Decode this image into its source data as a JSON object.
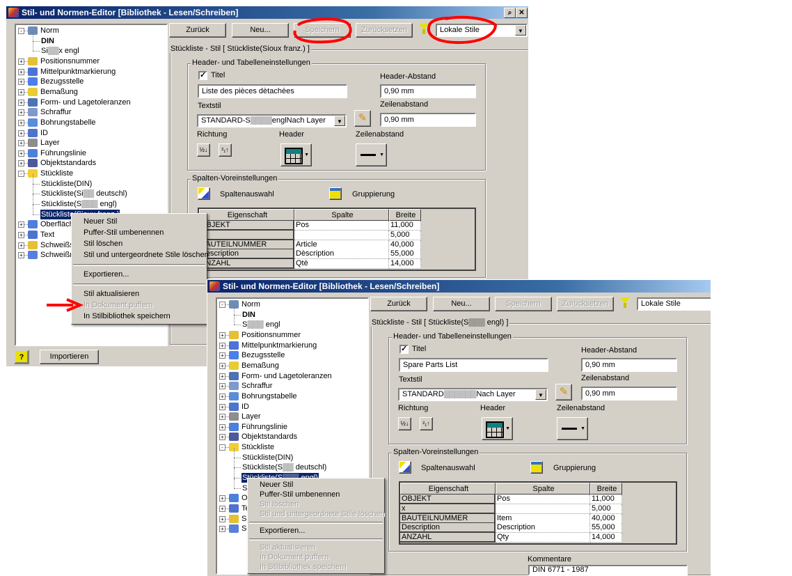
{
  "colors": {
    "titlebar": "#0a246a",
    "window_bg": "#d4d0c8",
    "selection": "#0a246a",
    "annotation": "#ff0000"
  },
  "windows": [
    {
      "title": "Stil- und Normen-Editor [Bibliothek - Lesen/Schreiben]",
      "titlebar_buttons": [
        "pin-icon",
        "close-icon"
      ],
      "tree": [
        {
          "label": "Norm",
          "level": 0,
          "exp": "-",
          "icon": "norm-icon"
        },
        {
          "label": "DIN",
          "level": 1,
          "bold": true
        },
        {
          "label": "Si▒▒x engl",
          "level": 1
        },
        {
          "label": "Positionsnummer",
          "level": 0,
          "exp": "+",
          "icon": "balloon-icon"
        },
        {
          "label": "Mittelpunktmarkierung",
          "level": 0,
          "exp": "+",
          "icon": "centermark-icon"
        },
        {
          "label": "Bezugsstelle",
          "level": 0,
          "exp": "+",
          "icon": "datum-icon"
        },
        {
          "label": "Bemaßung",
          "level": 0,
          "exp": "+",
          "icon": "dimension-icon"
        },
        {
          "label": "Form- und Lagetoleranzen",
          "level": 0,
          "exp": "+",
          "icon": "tolerance-icon"
        },
        {
          "label": "Schraffur",
          "level": 0,
          "exp": "+",
          "icon": "hatch-icon"
        },
        {
          "label": "Bohrungstabelle",
          "level": 0,
          "exp": "+",
          "icon": "holetable-icon"
        },
        {
          "label": "ID",
          "level": 0,
          "exp": "+",
          "icon": "id-icon"
        },
        {
          "label": "Layer",
          "level": 0,
          "exp": "+",
          "icon": "layer-icon"
        },
        {
          "label": "Führungslinie",
          "level": 0,
          "exp": "+",
          "icon": "leader-icon"
        },
        {
          "label": "Objektstandards",
          "level": 0,
          "exp": "+",
          "icon": "globe-icon"
        },
        {
          "label": "Stückliste",
          "level": 0,
          "exp": "-",
          "icon": "partslist-icon"
        },
        {
          "label": "Stückliste(DIN)",
          "level": 1
        },
        {
          "label": "Stückliste(Si▒▒ deutschl)",
          "level": 1
        },
        {
          "label": "Stückliste(S▒▒▒ engl)",
          "level": 1
        },
        {
          "label": "Stückliste(Sioux franz.)",
          "level": 1,
          "selected": true
        },
        {
          "label": "Oberfläch",
          "level": 0,
          "exp": "+",
          "icon": "surface-icon"
        },
        {
          "label": "Text",
          "level": 0,
          "exp": "+",
          "icon": "text-icon"
        },
        {
          "label": "Schweißsy",
          "level": 0,
          "exp": "+",
          "icon": "weldsymbol-icon"
        },
        {
          "label": "Schweißna",
          "level": 0,
          "exp": "+",
          "icon": "weldbead-icon"
        }
      ],
      "toolbar": {
        "back": "Zurück",
        "new": "Neu...",
        "save": "Speichern",
        "reset": "Zurücksetzen",
        "filter_value": "Lokale Stile"
      },
      "style_group_label": "Stückliste - Stil [ Stückliste(Sioux franz.) ]",
      "header_group": {
        "label": "Header- und Tabelleneinstellungen",
        "title_checkbox_label": "Titel",
        "title_checked": true,
        "title_value": "Liste des pièces dètachèes",
        "header_spacing_label": "Header-Abstand",
        "header_spacing_value": "0,90 mm",
        "textstyle_label": "Textstil",
        "textstyle_value": "STANDARD-S▒▒▒▒englNach Layer",
        "line_spacing_label": "Zeilenabstand",
        "line_spacing_value": "0,90 mm",
        "direction_label": "Richtung",
        "header_label": "Header",
        "line_spacing_label2": "Zeilenabstand"
      },
      "columns_group": {
        "label": "Spalten-Voreinstellungen",
        "column_select": "Spaltenauswahl",
        "grouping": "Gruppierung",
        "headers": [
          "Eigenschaft",
          "Spalte",
          "Breite"
        ],
        "rows": [
          [
            "OBJEKT",
            "Pos",
            "11,000"
          ],
          [
            "",
            "",
            "5,000"
          ],
          [
            "BAUTEILNUMMER",
            "Article",
            "40,000"
          ],
          [
            "Description",
            "Dèscription",
            "55,000"
          ],
          [
            "ANZAHL",
            "Qtè",
            "14,000"
          ]
        ]
      },
      "context_menu": [
        {
          "label": "Neuer Stil"
        },
        {
          "label": "Puffer-Stil umbenennen"
        },
        {
          "label": "Stil löschen"
        },
        {
          "label": "Stil und untergeordnete Stile löschen"
        },
        {
          "sep": true
        },
        {
          "label": "Exportieren..."
        },
        {
          "sep": true
        },
        {
          "label": "Stil aktualisieren"
        },
        {
          "label": "In Dokument puffern",
          "disabled": true
        },
        {
          "label": "In Stilbibliothek speichern"
        }
      ],
      "bottom": {
        "help": "?",
        "import": "Importieren"
      }
    },
    {
      "title": "Stil- und Normen-Editor [Bibliothek - Lesen/Schreiben]",
      "tree": [
        {
          "label": "Norm",
          "level": 0,
          "exp": "-",
          "icon": "norm-icon"
        },
        {
          "label": "DIN",
          "level": 1,
          "bold": true
        },
        {
          "label": "S▒▒▒ engl",
          "level": 1
        },
        {
          "label": "Positionsnummer",
          "level": 0,
          "exp": "+",
          "icon": "balloon-icon"
        },
        {
          "label": "Mittelpunktmarkierung",
          "level": 0,
          "exp": "+",
          "icon": "centermark-icon"
        },
        {
          "label": "Bezugsstelle",
          "level": 0,
          "exp": "+",
          "icon": "datum-icon"
        },
        {
          "label": "Bemaßung",
          "level": 0,
          "exp": "+",
          "icon": "dimension-icon"
        },
        {
          "label": "Form- und Lagetoleranzen",
          "level": 0,
          "exp": "+",
          "icon": "tolerance-icon"
        },
        {
          "label": "Schraffur",
          "level": 0,
          "exp": "+",
          "icon": "hatch-icon"
        },
        {
          "label": "Bohrungstabelle",
          "level": 0,
          "exp": "+",
          "icon": "holetable-icon"
        },
        {
          "label": "ID",
          "level": 0,
          "exp": "+",
          "icon": "id-icon"
        },
        {
          "label": "Layer",
          "level": 0,
          "exp": "+",
          "icon": "layer-icon"
        },
        {
          "label": "Führungslinie",
          "level": 0,
          "exp": "+",
          "icon": "leader-icon"
        },
        {
          "label": "Objektstandards",
          "level": 0,
          "exp": "+",
          "icon": "globe-icon"
        },
        {
          "label": "Stückliste",
          "level": 0,
          "exp": "-",
          "icon": "partslist-icon"
        },
        {
          "label": "Stückliste(DIN)",
          "level": 1
        },
        {
          "label": "Stückliste(S▒▒ deutschl)",
          "level": 1
        },
        {
          "label": "Stückliste(S▒▒▒ engl)",
          "level": 1,
          "selected": true
        },
        {
          "label": "St",
          "level": 1
        },
        {
          "label": "Ol",
          "level": 0,
          "exp": "+",
          "icon": "surface-icon"
        },
        {
          "label": "Te",
          "level": 0,
          "exp": "+",
          "icon": "text-icon"
        },
        {
          "label": "Sc",
          "level": 0,
          "exp": "+",
          "icon": "weldsymbol-icon"
        },
        {
          "label": "Sc",
          "level": 0,
          "exp": "+",
          "icon": "weldbead-icon"
        }
      ],
      "toolbar": {
        "back": "Zurück",
        "new": "Neu...",
        "save": "Speichern",
        "reset": "Zurücksetzen",
        "filter_value": "Lokale Stile"
      },
      "style_group_label": "Stückliste - Stil [ Stückliste(S▒▒▒ engl) ]",
      "header_group": {
        "label": "Header- und Tabelleneinstellungen",
        "title_checkbox_label": "Titel",
        "title_checked": true,
        "title_value": "Spare Parts List",
        "header_spacing_label": "Header-Abstand",
        "header_spacing_value": "0,90 mm",
        "textstyle_label": "Textstil",
        "textstyle_value": "STANDARD▒▒▒▒▒▒Nach Layer",
        "line_spacing_label": "Zeilenabstand",
        "line_spacing_value": "0,90 mm",
        "direction_label": "Richtung",
        "header_label": "Header",
        "line_spacing_label2": "Zeilenabstand"
      },
      "columns_group": {
        "label": "Spalten-Voreinstellungen",
        "column_select": "Spaltenauswahl",
        "grouping": "Gruppierung",
        "headers": [
          "Eigenschaft",
          "Spalte",
          "Breite"
        ],
        "rows": [
          [
            "OBJEKT",
            "Pos",
            "11,000"
          ],
          [
            "x",
            "",
            "5,000"
          ],
          [
            "BAUTEILNUMMER",
            "Item",
            "40,000"
          ],
          [
            "Description",
            "Description",
            "55,000"
          ],
          [
            "ANZAHL",
            "Qty",
            "14,000"
          ]
        ]
      },
      "comments": {
        "label": "Kommentare",
        "value": "DIN 6771 - 1987"
      },
      "context_menu": [
        {
          "label": "Neuer Stil"
        },
        {
          "label": "Puffer-Stil umbenennen"
        },
        {
          "label": "Stil löschen",
          "disabled": true
        },
        {
          "label": "Stil und untergeordnete Stile löschen",
          "disabled": true
        },
        {
          "sep": true
        },
        {
          "label": "Exportieren..."
        },
        {
          "sep": true
        },
        {
          "label": "Stil aktualisieren",
          "disabled": true
        },
        {
          "label": "In Dokument puffern",
          "disabled": true
        },
        {
          "label": "In Stilbibliothek speichern",
          "disabled": true
        }
      ]
    }
  ]
}
